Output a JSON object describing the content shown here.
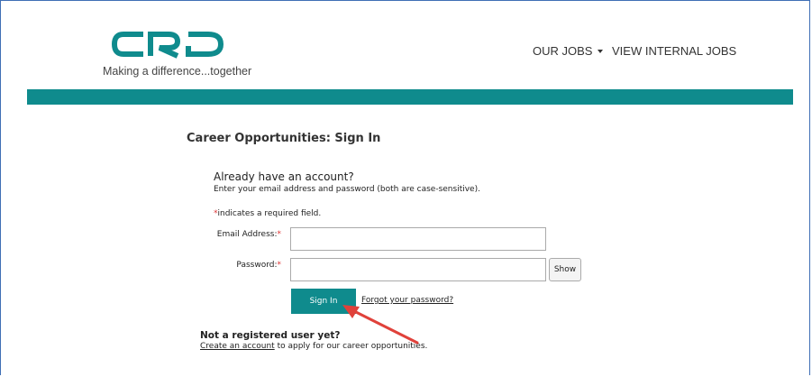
{
  "header": {
    "tagline": "Making a difference...together",
    "nav": [
      {
        "label": "OUR JOBS"
      },
      {
        "label": "VIEW INTERNAL JOBS"
      }
    ],
    "brand_color": "#0f8b8d"
  },
  "main": {
    "page_title": "Career Opportunities: Sign In",
    "section_title": "Already have an account?",
    "instructions": "Enter your email address and password (both are case-sensitive).",
    "required_marker": "*",
    "required_note": "indicates a required field.",
    "fields": {
      "email_label": "Email Address:",
      "email_value": "",
      "password_label": "Password:",
      "password_value": ""
    },
    "show_label": "Show",
    "signin_label": "Sign In",
    "forgot_label": "Forgot your password?",
    "not_registered": "Not a registered user yet?",
    "create_link": "Create an account",
    "create_suffix": " to apply for our career opportunities."
  },
  "annotation": {
    "arrow_color": "#e0413a",
    "icon": "red-arrow-icon"
  }
}
